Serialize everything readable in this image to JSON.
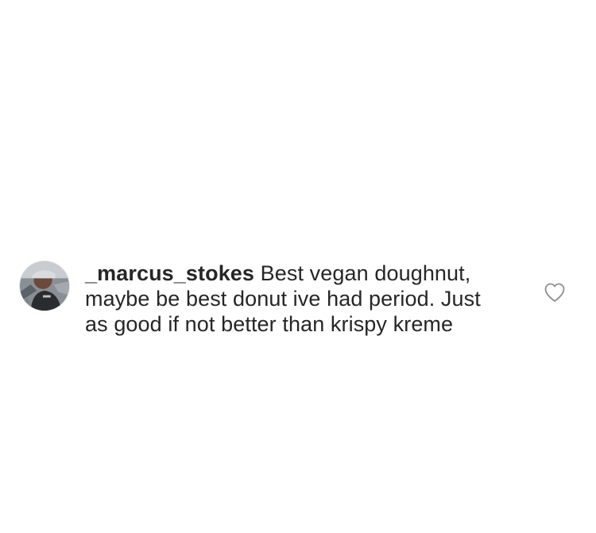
{
  "comment": {
    "username": "_marcus_stokes",
    "text": "Best vegan doughnut, maybe be best donut ive had period. Just as good if not better than krispy kreme",
    "avatar_icon": "profile-photo",
    "like_icon": "heart-outline-icon"
  }
}
